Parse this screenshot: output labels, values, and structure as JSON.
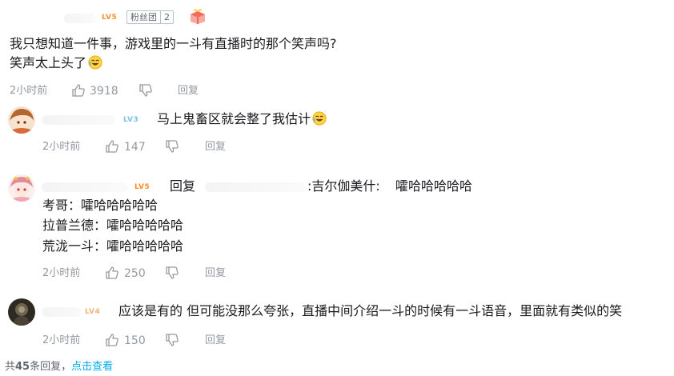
{
  "comment": {
    "level": "LV5",
    "fan_badge": {
      "name": "粉丝团",
      "count": "2"
    },
    "lines": [
      "我只想知道一件事，游戏里的一斗有直播时的那个笑声吗?",
      "笑声太上头了"
    ],
    "time": "2小时前",
    "likes": "3918",
    "reply_label": "回复"
  },
  "replies": [
    {
      "level": "LV3",
      "text": "马上鬼畜区就会整了我估计",
      "time": "2小时前",
      "likes": "147",
      "reply_label": "回复"
    },
    {
      "level": "LV5",
      "prefix": "回复",
      "mention": ":吉尔伽美什:",
      "first_line": "嚯哈哈哈哈哈",
      "lines": [
        "考哥：嚯哈哈哈哈哈",
        "拉普兰德：嚯哈哈哈哈哈",
        "荒泷一斗：嚯哈哈哈哈哈"
      ],
      "time": "2小时前",
      "likes": "250",
      "reply_label": "回复"
    },
    {
      "level": "LV4",
      "text": "应该是有的  但可能没那么夸张，直播中间介绍一斗的时候有一斗语音，里面就有类似的笑",
      "time": "2小时前",
      "likes": "150",
      "reply_label": "回复"
    }
  ],
  "footer": {
    "prefix": "共",
    "total": "45",
    "suffix": "条回复，",
    "link": "点击查看"
  },
  "colors": {
    "text": "#18191c",
    "meta": "#9499a0",
    "link": "#00aeec",
    "lv5": "#ff8c2b",
    "lv3": "#7fbfe6"
  }
}
